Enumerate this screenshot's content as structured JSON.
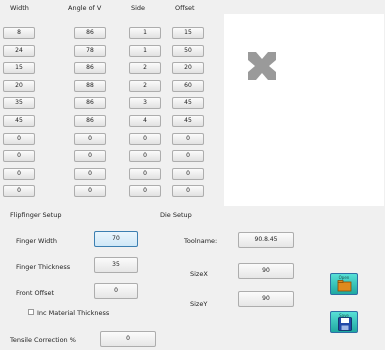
{
  "grid": {
    "headers": {
      "width": "Width",
      "angle": "Angle of V",
      "side": "Side",
      "offset": "Offset"
    },
    "rows": [
      {
        "width": "8",
        "angle": "86",
        "side": "1",
        "offset": "15"
      },
      {
        "width": "24",
        "angle": "78",
        "side": "1",
        "offset": "50"
      },
      {
        "width": "15",
        "angle": "86",
        "side": "2",
        "offset": "20"
      },
      {
        "width": "20",
        "angle": "88",
        "side": "2",
        "offset": "60"
      },
      {
        "width": "35",
        "angle": "86",
        "side": "3",
        "offset": "45"
      },
      {
        "width": "45",
        "angle": "86",
        "side": "4",
        "offset": "45"
      },
      {
        "width": "0",
        "angle": "0",
        "side": "0",
        "offset": "0"
      },
      {
        "width": "0",
        "angle": "0",
        "side": "0",
        "offset": "0"
      },
      {
        "width": "0",
        "angle": "0",
        "side": "0",
        "offset": "0"
      },
      {
        "width": "0",
        "angle": "0",
        "side": "0",
        "offset": "0"
      }
    ]
  },
  "flipfinger": {
    "section_label": "Flipfinger Setup",
    "finger_width_label": "Finger Width",
    "finger_width_value": "70",
    "finger_thickness_label": "Finger Thickness",
    "finger_thickness_value": "35",
    "front_offset_label": "Front Offset",
    "front_offset_value": "0",
    "inc_material_label": "Inc Material Thickness",
    "inc_material_checked": false
  },
  "die": {
    "section_label": "Die Setup",
    "toolname_label": "Toolname:",
    "toolname_value": "90.8.45",
    "sizex_label": "SizeX",
    "sizex_value": "90",
    "sizey_label": "SizeY",
    "sizey_value": "90"
  },
  "tensile": {
    "label": "Tensile Correction %",
    "value": "0"
  },
  "buttons": {
    "open_icon": "folder-open-icon",
    "save_icon": "floppy-disk-icon",
    "open_caption": "Open",
    "save_caption": "Save"
  },
  "colors": {
    "accent_teal": "#2bb5ad",
    "shape_grey": "#9a9a9a"
  }
}
